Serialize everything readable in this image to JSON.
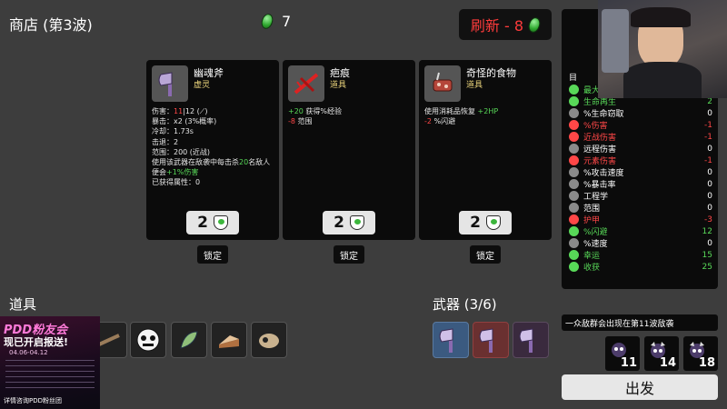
{
  "header": {
    "shop_title": "商店 (第3波)",
    "currency_count": "7",
    "reroll_label": "刷新 - 8"
  },
  "shop_cards": [
    {
      "name": "幽魂斧",
      "type": "虚灵",
      "desc_lines": [
        [
          "伤害：",
          "11",
          "|12 (",
          "⟋",
          ")"
        ],
        "暴击：x2 (3%概率)",
        "冷却：1.73s",
        "击退：2",
        "范围：200 (近战)",
        [
          "使用该武器在敌袭中每击杀",
          "20",
          "名敌人便会",
          "+1%伤害"
        ],
        "已获得属性：0"
      ],
      "price": "2",
      "lock_label": "锁定"
    },
    {
      "name": "疤痕",
      "type": "道具",
      "desc_lines": [
        [
          "+20",
          " 获得%经验"
        ],
        [
          "-8",
          " 范围"
        ]
      ],
      "price": "2",
      "lock_label": "锁定"
    },
    {
      "name": "奇怪的食物",
      "type": "道具",
      "desc_lines": [
        [
          "使用消耗品恢复 ",
          "+2HP"
        ],
        [
          "-2",
          " %闪避"
        ]
      ],
      "price": "2",
      "lock_label": "锁定"
    }
  ],
  "stats_panel": {
    "header_partial": "目",
    "rows": [
      {
        "label": "最大生命值",
        "value": "",
        "color": "#58d858",
        "icon": "heart-icon",
        "label_color": "#58d858"
      },
      {
        "label": "生命再生",
        "value": "2",
        "color": "#58d858",
        "icon": "regen-icon",
        "label_color": "#58d858"
      },
      {
        "label": "%生命窃取",
        "value": "0",
        "color": "#ffffff",
        "icon": "lifesteal-icon",
        "label_color": "#ffffff"
      },
      {
        "label": "%伤害",
        "value": "-1",
        "color": "#ff4747",
        "icon": "damage-icon",
        "label_color": "#ff4747"
      },
      {
        "label": "近战伤害",
        "value": "-1",
        "color": "#ff4747",
        "icon": "melee-icon",
        "label_color": "#ff4747"
      },
      {
        "label": "远程伤害",
        "value": "0",
        "color": "#ffffff",
        "icon": "ranged-icon",
        "label_color": "#ffffff"
      },
      {
        "label": "元素伤害",
        "value": "-1",
        "color": "#ff4747",
        "icon": "elemental-icon",
        "label_color": "#ff4747"
      },
      {
        "label": "%攻击速度",
        "value": "0",
        "color": "#ffffff",
        "icon": "attack-speed-icon",
        "label_color": "#ffffff"
      },
      {
        "label": "%暴击率",
        "value": "0",
        "color": "#ffffff",
        "icon": "crit-icon",
        "label_color": "#ffffff"
      },
      {
        "label": "工程学",
        "value": "0",
        "color": "#ffffff",
        "icon": "engineering-icon",
        "label_color": "#ffffff"
      },
      {
        "label": "范围",
        "value": "0",
        "color": "#ffffff",
        "icon": "range-icon",
        "label_color": "#ffffff"
      },
      {
        "label": "护甲",
        "value": "-3",
        "color": "#ff4747",
        "icon": "armor-icon",
        "label_color": "#ff4747"
      },
      {
        "label": "%闪避",
        "value": "12",
        "color": "#58d858",
        "icon": "dodge-icon",
        "label_color": "#58d858"
      },
      {
        "label": "%速度",
        "value": "0",
        "color": "#ffffff",
        "icon": "speed-icon",
        "label_color": "#ffffff"
      },
      {
        "label": "幸运",
        "value": "15",
        "color": "#58d858",
        "icon": "luck-icon",
        "label_color": "#58d858"
      },
      {
        "label": "收获",
        "value": "25",
        "color": "#58d858",
        "icon": "harvest-icon",
        "label_color": "#58d858"
      }
    ]
  },
  "sections": {
    "items_label": "道具",
    "weapons_label": "武器 (3/6)"
  },
  "wave_notice": "一众敌群会出现在第11波敌袭",
  "enemy_waves": [
    "11",
    "14",
    "18"
  ],
  "go_button": "出发",
  "overlay_promo": {
    "title_line1": "PDD粉友会",
    "title_line2": "现已开启报送!",
    "dates": "04.06-04.12",
    "footer": "详情咨询PDD粉丝团"
  },
  "colors": {
    "background": "#3d3d3d",
    "panel": "#0b0b0b",
    "positive": "#58d858",
    "negative": "#ff4747",
    "item_type": "#e8d27a",
    "weapon_slot_bg": "#3b5a80"
  }
}
